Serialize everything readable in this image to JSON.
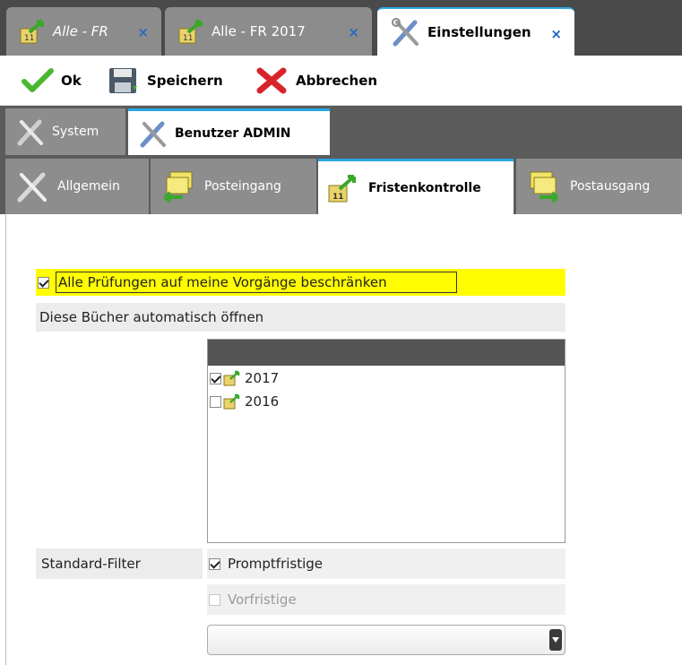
{
  "doc_tabs": [
    {
      "label": "Alle - FR",
      "italic": true,
      "close": "×"
    },
    {
      "label": "Alle - FR 2017",
      "italic": false,
      "close": "×"
    },
    {
      "label": "Einstellungen",
      "italic": false,
      "close": "×"
    }
  ],
  "toolbar": {
    "ok": "Ok",
    "save": "Speichern",
    "cancel": "Abbrechen"
  },
  "section_tabs": {
    "system": "System",
    "user": "Benutzer ADMIN"
  },
  "sub_tabs": {
    "general": "Allgemein",
    "inbox": "Posteingang",
    "deadlines": "Fristenkontrolle",
    "outbox": "Postausgang"
  },
  "settings": {
    "restrict_label": "Alle Prüfungen auf meine Vorgänge beschränken",
    "restrict_checked": true,
    "books_label": "Diese Bücher automatisch öffnen",
    "books": [
      {
        "name": "2017",
        "checked": true
      },
      {
        "name": "2016",
        "checked": false
      }
    ],
    "filter_label": "Standard-Filter",
    "filters": [
      {
        "name": "Promptfristige",
        "checked": true,
        "enabled": true
      },
      {
        "name": "Vorfristige",
        "checked": false,
        "enabled": false
      }
    ],
    "dropdown_value": ""
  },
  "colors": {
    "highlight": "#fffd00",
    "accent": "#29a8e0",
    "tab_bg": "#5b5b5b"
  }
}
